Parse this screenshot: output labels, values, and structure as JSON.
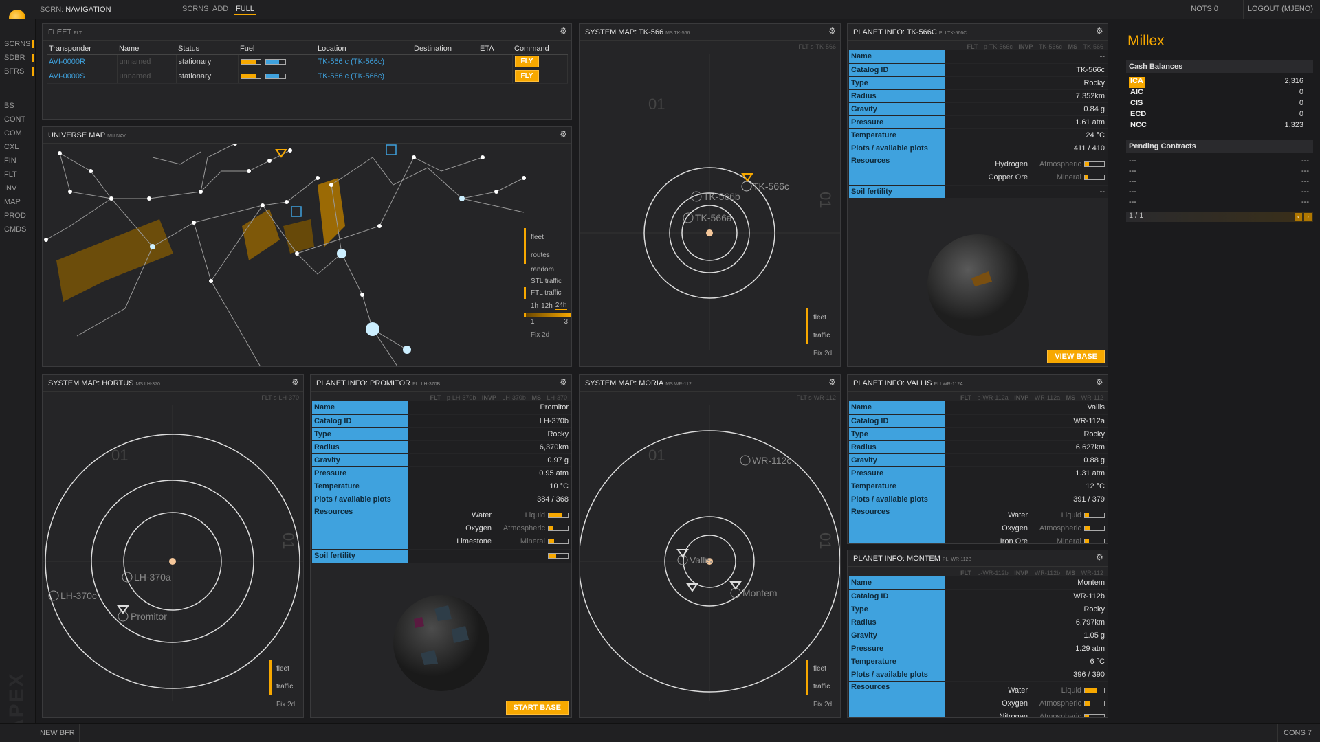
{
  "topbar": {
    "screen_prefix": "SCRN:",
    "screen_name": "NAVIGATION",
    "nav": [
      "SCRNS",
      "ADD",
      "FULL"
    ],
    "notifs": "NOTS 0",
    "logout": "LOGOUT (MJENO)"
  },
  "leftnav": {
    "items": [
      "SCRNS",
      "SDBR",
      "BFRS",
      "BS",
      "CONT",
      "COM",
      "CXL",
      "FIN",
      "FLT",
      "INV",
      "MAP",
      "PROD",
      "CMDS"
    ]
  },
  "watermark": "APEX",
  "bottombar": {
    "new_bfr": "NEW BFR",
    "cons": "CONS 7"
  },
  "fleet": {
    "title": "FLEET",
    "cmd": "FLT",
    "columns": [
      "Transponder",
      "Name",
      "Status",
      "Fuel",
      "Location",
      "Destination",
      "ETA",
      "Command"
    ],
    "rows": [
      {
        "transponder": "AVI-0000R",
        "name": "unnamed",
        "status": "stationary",
        "fuel_stl": 0.8,
        "fuel_ftl": 0.7,
        "location": "TK-566 c (TK-566c)",
        "destination": "",
        "eta": "",
        "command": "FLY"
      },
      {
        "transponder": "AVI-0000S",
        "name": "unnamed",
        "status": "stationary",
        "fuel_stl": 0.8,
        "fuel_ftl": 0.7,
        "location": "TK-566 c (TK-566c)",
        "destination": "",
        "eta": "",
        "command": "FLY"
      }
    ]
  },
  "universe": {
    "title": "UNIVERSE MAP",
    "cmd": "MU NAV",
    "legend": [
      "fleet",
      "routes",
      "random",
      "STL traffic",
      "FTL traffic"
    ],
    "times": [
      "1h",
      "12h",
      "24h"
    ],
    "scale": [
      "1",
      "3"
    ],
    "fix": "Fix 2d"
  },
  "sysmap_tk": {
    "title": "SYSTEM MAP: TK-566",
    "cmd": "MS TK-566",
    "sub": "FLT s-TK-566",
    "section": "01",
    "labels": [
      "TK-566c",
      "TK-566b",
      "TK-566a"
    ],
    "legend": [
      "fleet",
      "traffic"
    ],
    "fix": "Fix 2d"
  },
  "planet_tk": {
    "title": "PLANET INFO: TK-566C",
    "cmd": "PLI TK-566C",
    "sub": [
      {
        "k": "FLT",
        "v": "p-TK-566c"
      },
      {
        "k": "INVP",
        "v": "TK-566c"
      },
      {
        "k": "MS",
        "v": "TK-566"
      }
    ],
    "rows": [
      [
        "Name",
        "--"
      ],
      [
        "Catalog ID",
        "TK-566c"
      ],
      [
        "Type",
        "Rocky"
      ],
      [
        "Radius",
        "7,352km"
      ],
      [
        "Gravity",
        "0.84 g"
      ],
      [
        "Pressure",
        "1.61 atm"
      ],
      [
        "Temperature",
        "24 °C"
      ],
      [
        "Plots / available plots",
        "411 / 410"
      ]
    ],
    "resources_label": "Resources",
    "resources": [
      {
        "name": "Hydrogen",
        "type": "Atmospheric",
        "level": 0.2
      },
      {
        "name": "Copper Ore",
        "type": "Mineral",
        "level": 0.15
      }
    ],
    "soil_label": "Soil fertility",
    "soil": "--",
    "button": "VIEW BASE"
  },
  "sysmap_hortus": {
    "title": "SYSTEM MAP: HORTUS",
    "cmd": "MS LH-370",
    "sub": "FLT s-LH-370",
    "section": "01",
    "labels": [
      "LH-370a",
      "LH-370c",
      "Promitor"
    ],
    "legend": [
      "fleet",
      "traffic"
    ],
    "fix": "Fix 2d"
  },
  "planet_promitor": {
    "title": "PLANET INFO: PROMITOR",
    "cmd": "PLI LH-370B",
    "sub": [
      {
        "k": "FLT",
        "v": "p-LH-370b"
      },
      {
        "k": "INVP",
        "v": "LH-370b"
      },
      {
        "k": "MS",
        "v": "LH-370"
      }
    ],
    "rows": [
      [
        "Name",
        "Promitor"
      ],
      [
        "Catalog ID",
        "LH-370b"
      ],
      [
        "Type",
        "Rocky"
      ],
      [
        "Radius",
        "6,370km"
      ],
      [
        "Gravity",
        "0.97 g"
      ],
      [
        "Pressure",
        "0.95 atm"
      ],
      [
        "Temperature",
        "10 °C"
      ],
      [
        "Plots / available plots",
        "384 / 368"
      ]
    ],
    "resources_label": "Resources",
    "resources": [
      {
        "name": "Water",
        "type": "Liquid",
        "level": 0.7
      },
      {
        "name": "Oxygen",
        "type": "Atmospheric",
        "level": 0.25
      },
      {
        "name": "Limestone",
        "type": "Mineral",
        "level": 0.3
      }
    ],
    "soil_label": "Soil fertility",
    "soil_level": 0.4,
    "button": "START BASE"
  },
  "sysmap_moria": {
    "title": "SYSTEM MAP: MORIA",
    "cmd": "MS WR-112",
    "sub": "FLT s-WR-112",
    "section": "01",
    "labels": [
      "WR-112c",
      "Vallis",
      "Montem"
    ],
    "legend": [
      "fleet",
      "traffic"
    ],
    "fix": "Fix 2d"
  },
  "planet_vallis": {
    "title": "PLANET INFO: VALLIS",
    "cmd": "PLI WR-112A",
    "sub": [
      {
        "k": "FLT",
        "v": "p-WR-112a"
      },
      {
        "k": "INVP",
        "v": "WR-112a"
      },
      {
        "k": "MS",
        "v": "WR-112"
      }
    ],
    "rows": [
      [
        "Name",
        "Vallis"
      ],
      [
        "Catalog ID",
        "WR-112a"
      ],
      [
        "Type",
        "Rocky"
      ],
      [
        "Radius",
        "6,627km"
      ],
      [
        "Gravity",
        "0.88 g"
      ],
      [
        "Pressure",
        "1.31 atm"
      ],
      [
        "Temperature",
        "12 °C"
      ],
      [
        "Plots / available plots",
        "391 / 379"
      ]
    ],
    "resources_label": "Resources",
    "resources": [
      {
        "name": "Water",
        "type": "Liquid",
        "level": 0.2
      },
      {
        "name": "Oxygen",
        "type": "Atmospheric",
        "level": 0.3
      },
      {
        "name": "Iron Ore",
        "type": "Mineral",
        "level": 0.2
      }
    ]
  },
  "planet_montem": {
    "title": "PLANET INFO: MONTEM",
    "cmd": "PLI WR-112B",
    "sub": [
      {
        "k": "FLT",
        "v": "p-WR-112b"
      },
      {
        "k": "INVP",
        "v": "WR-112b"
      },
      {
        "k": "MS",
        "v": "WR-112"
      }
    ],
    "rows": [
      [
        "Name",
        "Montem"
      ],
      [
        "Catalog ID",
        "WR-112b"
      ],
      [
        "Type",
        "Rocky"
      ],
      [
        "Radius",
        "6,797km"
      ],
      [
        "Gravity",
        "1.05 g"
      ],
      [
        "Pressure",
        "1.29 atm"
      ],
      [
        "Temperature",
        "6 °C"
      ],
      [
        "Plots / available plots",
        "396 / 390"
      ]
    ],
    "resources_label": "Resources",
    "resources": [
      {
        "name": "Water",
        "type": "Liquid",
        "level": 0.6
      },
      {
        "name": "Oxygen",
        "type": "Atmospheric",
        "level": 0.3
      },
      {
        "name": "Nitrogen",
        "type": "Atmospheric",
        "level": 0.2
      }
    ]
  },
  "company": {
    "name": "Millex",
    "cash_title": "Cash Balances",
    "balances": [
      {
        "c": "ICA",
        "a": "2,316"
      },
      {
        "c": "AIC",
        "a": "0"
      },
      {
        "c": "CIS",
        "a": "0"
      },
      {
        "c": "ECD",
        "a": "0"
      },
      {
        "c": "NCC",
        "a": "1,323"
      }
    ],
    "pending_title": "Pending Contracts",
    "pending": [
      [
        "---",
        "---"
      ],
      [
        "---",
        "---"
      ],
      [
        "---",
        "---"
      ],
      [
        "---",
        "---"
      ],
      [
        "---",
        "---"
      ]
    ],
    "page": "1 / 1"
  },
  "colors": {
    "accent": "#f7a800",
    "link": "#3fa2de",
    "panel": "#252527",
    "bg": "#1b1b1d"
  }
}
